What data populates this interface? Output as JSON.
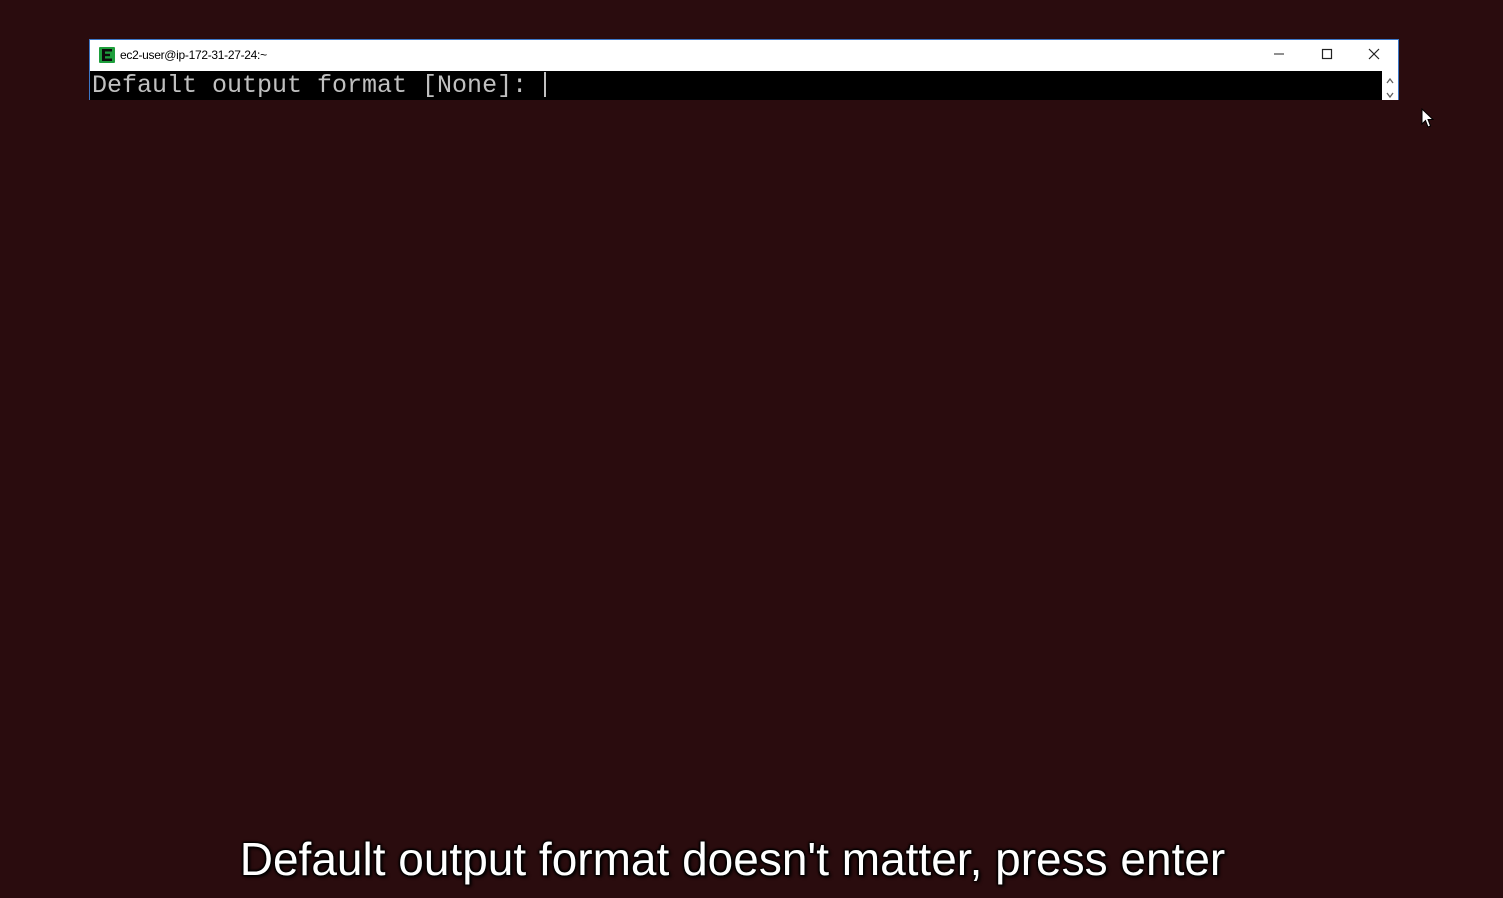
{
  "colors": {
    "desktop_background": "#2a0c0e",
    "window_border": "#3c78c8",
    "console_background": "#000000",
    "console_text": "#c0c0c0",
    "app_icon_green": "#1e9e3c",
    "caption_text": "#ffffff"
  },
  "window": {
    "title": "ec2-user@ip-172-31-27-24:~",
    "app_icon": "terminal-e-icon",
    "minimize_icon": "minimize-icon",
    "maximize_icon": "maximize-icon",
    "close_icon": "close-icon"
  },
  "console": {
    "prompt_line": "Default output format [None]: ",
    "input_value": ""
  },
  "scrollbar": {
    "up_icon": "chevron-up-icon",
    "down_icon": "chevron-down-icon"
  },
  "pointer": {
    "icon": "mouse-pointer-icon"
  },
  "caption": {
    "text": "Default output format doesn't matter, press enter"
  }
}
